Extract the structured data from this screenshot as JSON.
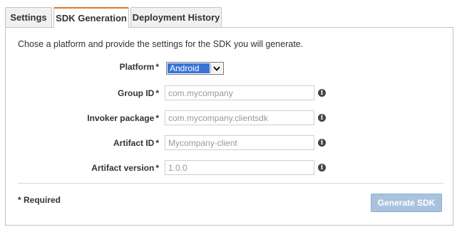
{
  "tabs": [
    {
      "label": "Settings"
    },
    {
      "label": "SDK Generation"
    },
    {
      "label": "Deployment History"
    }
  ],
  "intro": "Chose a platform and provide the settings for the SDK you will generate.",
  "form": {
    "platform": {
      "label": "Platform",
      "required_mark": "*",
      "selected": "Android"
    },
    "group_id": {
      "label": "Group ID",
      "required_mark": "*",
      "placeholder": "com.mycompany"
    },
    "invoker_package": {
      "label": "Invoker package",
      "required_mark": "*",
      "placeholder": "com.mycompany.clientsdk"
    },
    "artifact_id": {
      "label": "Artifact ID",
      "required_mark": "*",
      "placeholder": "Mycompany-client"
    },
    "artifact_version": {
      "label": "Artifact version",
      "required_mark": "*",
      "placeholder": "1.0.0"
    }
  },
  "footer": {
    "required_note": "* Required",
    "generate_label": "Generate SDK"
  },
  "info_glyph": "i",
  "colors": {
    "active_tab_accent": "#e4761b",
    "selected_option_bg": "#3875d7",
    "button_bg": "#a9c3df"
  }
}
